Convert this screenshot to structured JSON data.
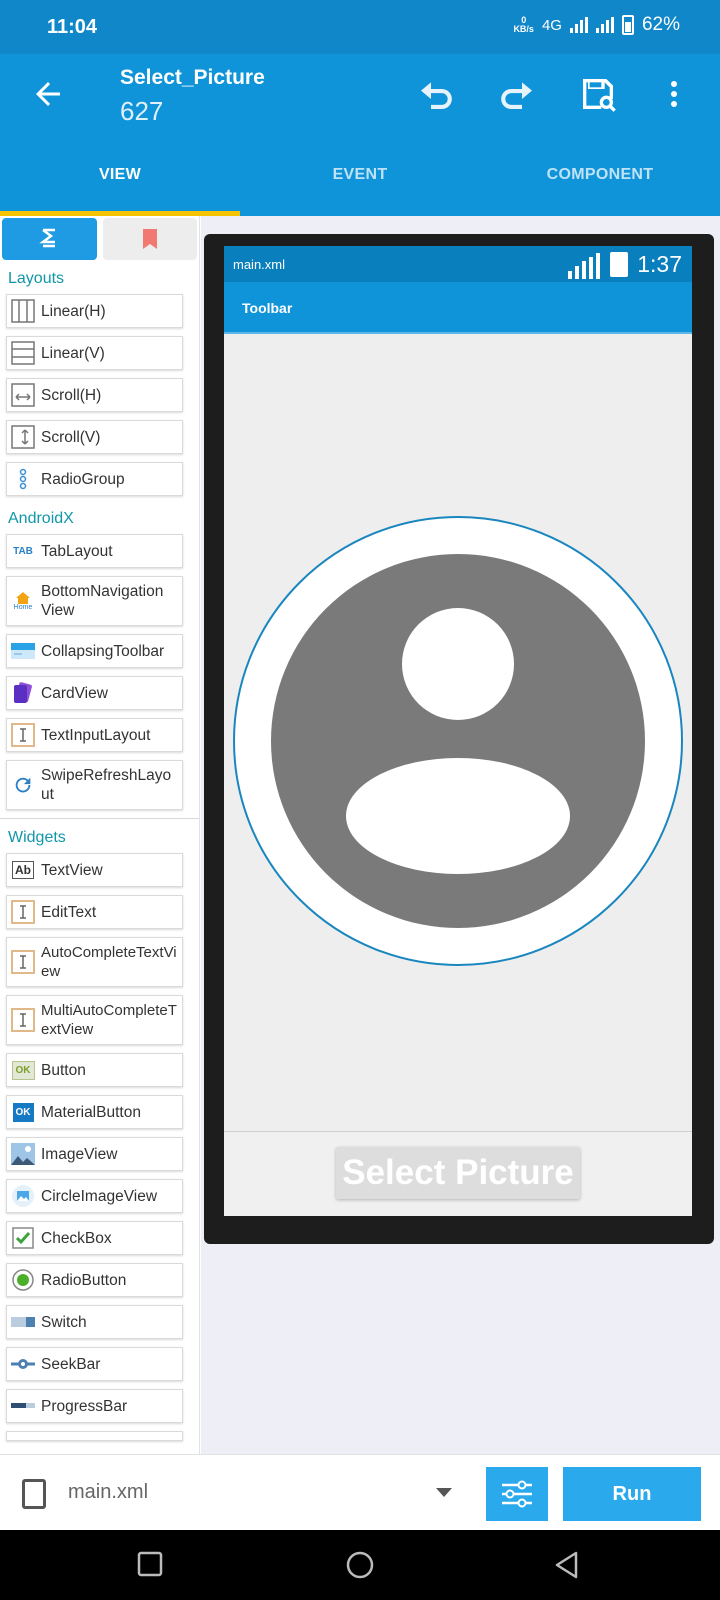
{
  "status_bar": {
    "time": "11:04",
    "kbs_value": "0",
    "kbs_unit": "KB/s",
    "network": "4G",
    "battery": "62%"
  },
  "app_bar": {
    "title": "Select_Picture",
    "subtitle": "627",
    "icons": [
      "back-arrow-icon",
      "undo-icon",
      "redo-icon",
      "save-icon",
      "more-vert-icon"
    ]
  },
  "tabs": [
    {
      "label": "VIEW",
      "active": true
    },
    {
      "label": "EVENT",
      "active": false
    },
    {
      "label": "COMPONENT",
      "active": false
    }
  ],
  "palette": {
    "sections": {
      "layouts": "Layouts",
      "androidx": "AndroidX",
      "widgets": "Widgets"
    },
    "layouts": [
      "Linear(H)",
      "Linear(V)",
      "Scroll(H)",
      "Scroll(V)",
      "RadioGroup"
    ],
    "androidx": [
      "TabLayout",
      "BottomNavigation View",
      "CollapsingToolbar",
      "CardView",
      "TextInputLayout",
      "SwipeRefreshLayo ut"
    ],
    "widgets": [
      "TextView",
      "EditText",
      "AutoCompleteTextVi ew",
      "MultiAutoCompleteT extView",
      "Button",
      "MaterialButton",
      "ImageView",
      "CircleImageView",
      "CheckBox",
      "RadioButton",
      "Switch",
      "SeekBar",
      "ProgressBar"
    ],
    "icon_text": {
      "tab": "TAB",
      "home": "Home",
      "ab": "Ab",
      "ok": "OK"
    }
  },
  "preview": {
    "file_name": "main.xml",
    "time": "1:37",
    "toolbar_title": "Toolbar",
    "button_label": "Select Picture"
  },
  "bottom_bar": {
    "file": "main.xml",
    "run_label": "Run"
  },
  "colors": {
    "primary": "#0f94d9",
    "status": "#0f87c9",
    "accent": "#f5c400",
    "section_text": "#1197a9",
    "run_button": "#2aa9ec"
  }
}
